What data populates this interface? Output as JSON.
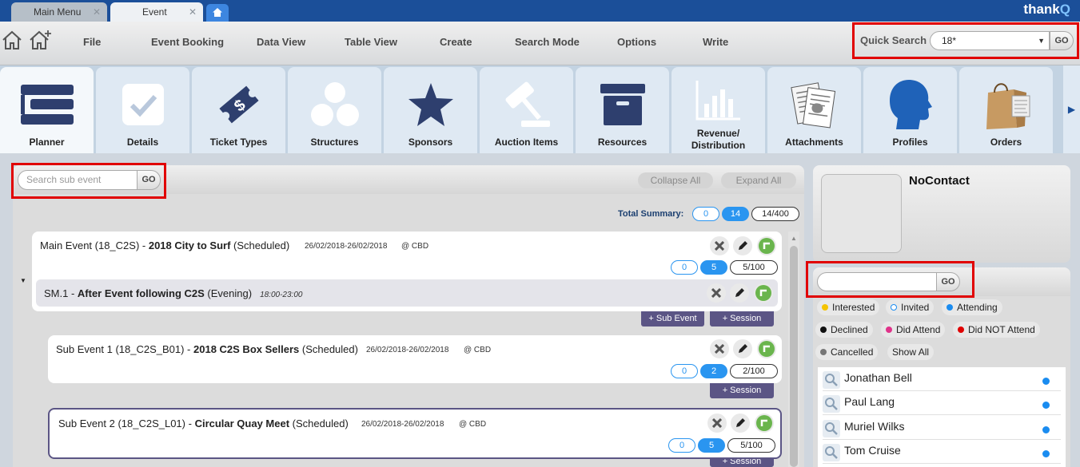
{
  "tabs": {
    "main_menu": "Main Menu",
    "event": "Event",
    "close_glyph": "✕",
    "brand_a": "thank",
    "brand_b": "Q"
  },
  "menu": {
    "file": "File",
    "event_booking": "Event Booking",
    "data_view": "Data View",
    "table_view": "Table View",
    "create": "Create",
    "search_mode": "Search Mode",
    "options": "Options",
    "write": "Write"
  },
  "quick_search": {
    "label": "Quick Search",
    "value": "18*",
    "go": "GO"
  },
  "modules": [
    {
      "label": "Planner",
      "icon": "planner-icon"
    },
    {
      "label": "Details",
      "icon": "checkmark-icon"
    },
    {
      "label": "Ticket Types",
      "icon": "ticket-icon"
    },
    {
      "label": "Structures",
      "icon": "structures-icon"
    },
    {
      "label": "Sponsors",
      "icon": "star-icon"
    },
    {
      "label": "Auction Items",
      "icon": "gavel-icon"
    },
    {
      "label": "Resources",
      "icon": "archive-box-icon"
    },
    {
      "label": "Revenue/ Distribution",
      "icon": "bar-chart-icon"
    },
    {
      "label": "Attachments",
      "icon": "documents-icon"
    },
    {
      "label": "Profiles",
      "icon": "profile-head-icon"
    },
    {
      "label": "Orders",
      "icon": "shopping-bag-icon"
    }
  ],
  "ribbon_arrow": "▶",
  "subevent_search": {
    "placeholder": "Search sub event",
    "go": "GO",
    "collapse_all": "Collapse All",
    "expand_all": "Expand All"
  },
  "total_summary": {
    "label": "Total Summary:",
    "a": "0",
    "b": "14",
    "c": "14/400"
  },
  "main_event": {
    "prefix": "Main Event (18_C2S) - ",
    "name": "2018 City to Surf",
    "status": " (Scheduled)",
    "dates": "26/02/2018-26/02/2018",
    "location": "@ CBD",
    "count_a": "0",
    "count_b": "5",
    "count_c": "5/100",
    "session_prefix": "SM.1 - ",
    "session_name": "After Event following C2S",
    "session_status": " (Evening)",
    "session_time": "18:00-23:00",
    "add_sub_event": "+ Sub Event",
    "add_session": "+ Session"
  },
  "sub_events": [
    {
      "prefix": "Sub Event 1 (18_C2S_B01) - ",
      "name": "2018 C2S Box Sellers",
      "status": " (Scheduled)",
      "dates": "26/02/2018-26/02/2018",
      "location": "@ CBD",
      "count_a": "0",
      "count_b": "2",
      "count_c": "2/100",
      "add_session": "+ Session"
    },
    {
      "prefix": "Sub Event 2 (18_C2S_L01) - ",
      "name": "Circular Quay Meet",
      "status": " (Scheduled)",
      "dates": "26/02/2018-26/02/2018",
      "location": "@ CBD",
      "count_a": "0",
      "count_b": "5",
      "count_c": "5/100",
      "add_session": "+ Session"
    }
  ],
  "contact": {
    "name": "NoContact"
  },
  "attendees": {
    "go": "GO",
    "filters": [
      {
        "label": "Interested",
        "color": "#f5c400"
      },
      {
        "label": "Invited",
        "color": "#ffffff"
      },
      {
        "label": "Attending",
        "color": "#1a8cf0"
      },
      {
        "label": "Declined",
        "color": "#111111"
      },
      {
        "label": "Did Attend",
        "color": "#e0338a"
      },
      {
        "label": "Did NOT Attend",
        "color": "#e00000"
      },
      {
        "label": "Cancelled",
        "color": "#777777"
      },
      {
        "label": "Show All",
        "color": ""
      }
    ],
    "people": [
      {
        "name": "Jonathan Bell",
        "status_color": "#1a8cf0"
      },
      {
        "name": "Paul Lang",
        "status_color": "#1a8cf0"
      },
      {
        "name": "Muriel Wilks",
        "status_color": "#1a8cf0"
      },
      {
        "name": "Tom Cruise",
        "status_color": "#1a8cf0"
      }
    ]
  }
}
